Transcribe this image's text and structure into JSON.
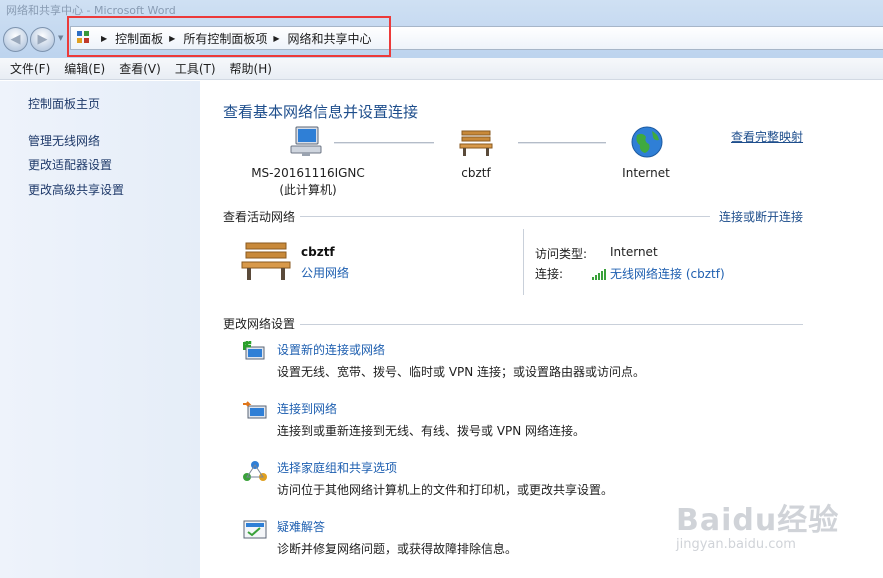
{
  "window": {
    "title": "网络和共享中心 - Microsoft Word"
  },
  "address_bar": {
    "crumbs": [
      "控制面板",
      "所有控制面板项",
      "网络和共享中心"
    ]
  },
  "menu": {
    "items": [
      "文件(F)",
      "编辑(E)",
      "查看(V)",
      "工具(T)",
      "帮助(H)"
    ]
  },
  "sidebar": {
    "home": "控制面板主页",
    "links": [
      "管理无线网络",
      "更改适配器设置",
      "更改高级共享设置"
    ]
  },
  "main": {
    "title": "查看基本网络信息并设置连接",
    "full_map_link": "查看完整映射",
    "map": {
      "computer_name": "MS-20161116IGNC",
      "computer_sub": "(此计算机)",
      "network_name": "cbztf",
      "internet": "Internet"
    },
    "active_networks": {
      "heading": "查看活动网络",
      "connect_link": "连接或断开连接",
      "network_name": "cbztf",
      "network_type": "公用网络",
      "access_type_label": "访问类型:",
      "access_type_value": "Internet",
      "connection_label": "连接:",
      "connection_value": "无线网络连接 (cbztf)"
    },
    "change_settings": {
      "heading": "更改网络设置",
      "tasks": [
        {
          "title": "设置新的连接或网络",
          "desc": "设置无线、宽带、拨号、临时或 VPN 连接；或设置路由器或访问点。",
          "icon": "new-connection-icon"
        },
        {
          "title": "连接到网络",
          "desc": "连接到或重新连接到无线、有线、拨号或 VPN 网络连接。",
          "icon": "connect-network-icon"
        },
        {
          "title": "选择家庭组和共享选项",
          "desc": "访问位于其他网络计算机上的文件和打印机，或更改共享设置。",
          "icon": "homegroup-icon"
        },
        {
          "title": "疑难解答",
          "desc": "诊断并修复网络问题，或获得故障排除信息。",
          "icon": "troubleshoot-icon"
        }
      ]
    }
  },
  "watermark": {
    "main": "Baidu经验",
    "sub": "jingyan.baidu.com"
  },
  "colors": {
    "link": "#1e5fb0",
    "title": "#1e4e8c",
    "highlight_box": "#ec3a3a",
    "sidebar_bg": "#e9f0f9"
  }
}
